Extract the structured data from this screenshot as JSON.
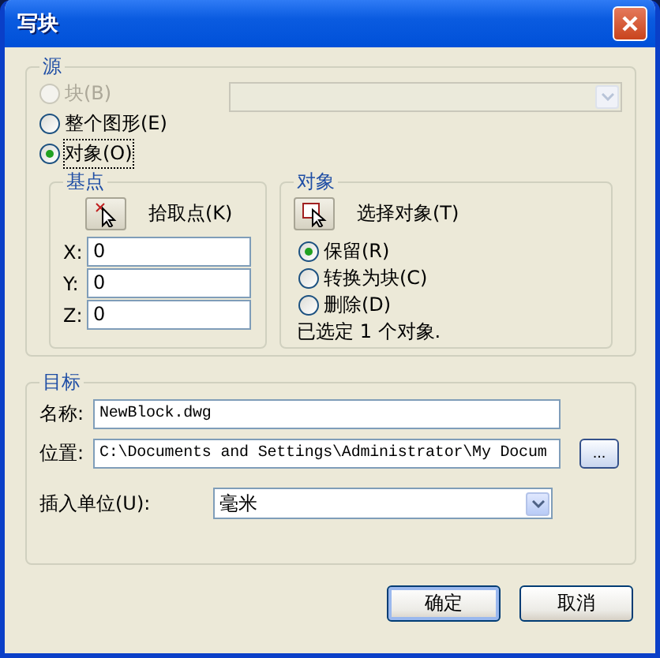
{
  "window": {
    "title": "写块"
  },
  "source": {
    "label": "源",
    "combo": {
      "disabled": true
    },
    "options": [
      {
        "label": "块(B)",
        "selected": false,
        "disabled": true
      },
      {
        "label": "整个图形(E)",
        "selected": false,
        "disabled": false
      },
      {
        "label": "对象(O)",
        "selected": true,
        "disabled": false
      }
    ]
  },
  "base_point": {
    "label": "基点",
    "pick_button": {
      "label": "拾取点(K)"
    },
    "coords": [
      {
        "label": "X:",
        "value": "0"
      },
      {
        "label": "Y:",
        "value": "0"
      },
      {
        "label": "Z:",
        "value": "0"
      }
    ]
  },
  "objects": {
    "label": "对象",
    "select_button": {
      "label": "选择对象(T)"
    },
    "options": [
      {
        "label": "保留(R)",
        "selected": true
      },
      {
        "label": "转换为块(C)",
        "selected": false
      },
      {
        "label": "删除(D)",
        "selected": false
      }
    ],
    "status": "已选定 1 个对象."
  },
  "destination": {
    "label": "目标",
    "name": {
      "label": "名称:",
      "value": "NewBlock.dwg"
    },
    "location": {
      "label": "位置:",
      "value": "C:\\Documents and Settings\\Administrator\\My Docum",
      "browse": "..."
    },
    "units": {
      "label": "插入单位(U):",
      "value": "毫米"
    }
  },
  "buttons": [
    {
      "label": "确定",
      "default": true
    },
    {
      "label": "取消",
      "default": false
    }
  ]
}
